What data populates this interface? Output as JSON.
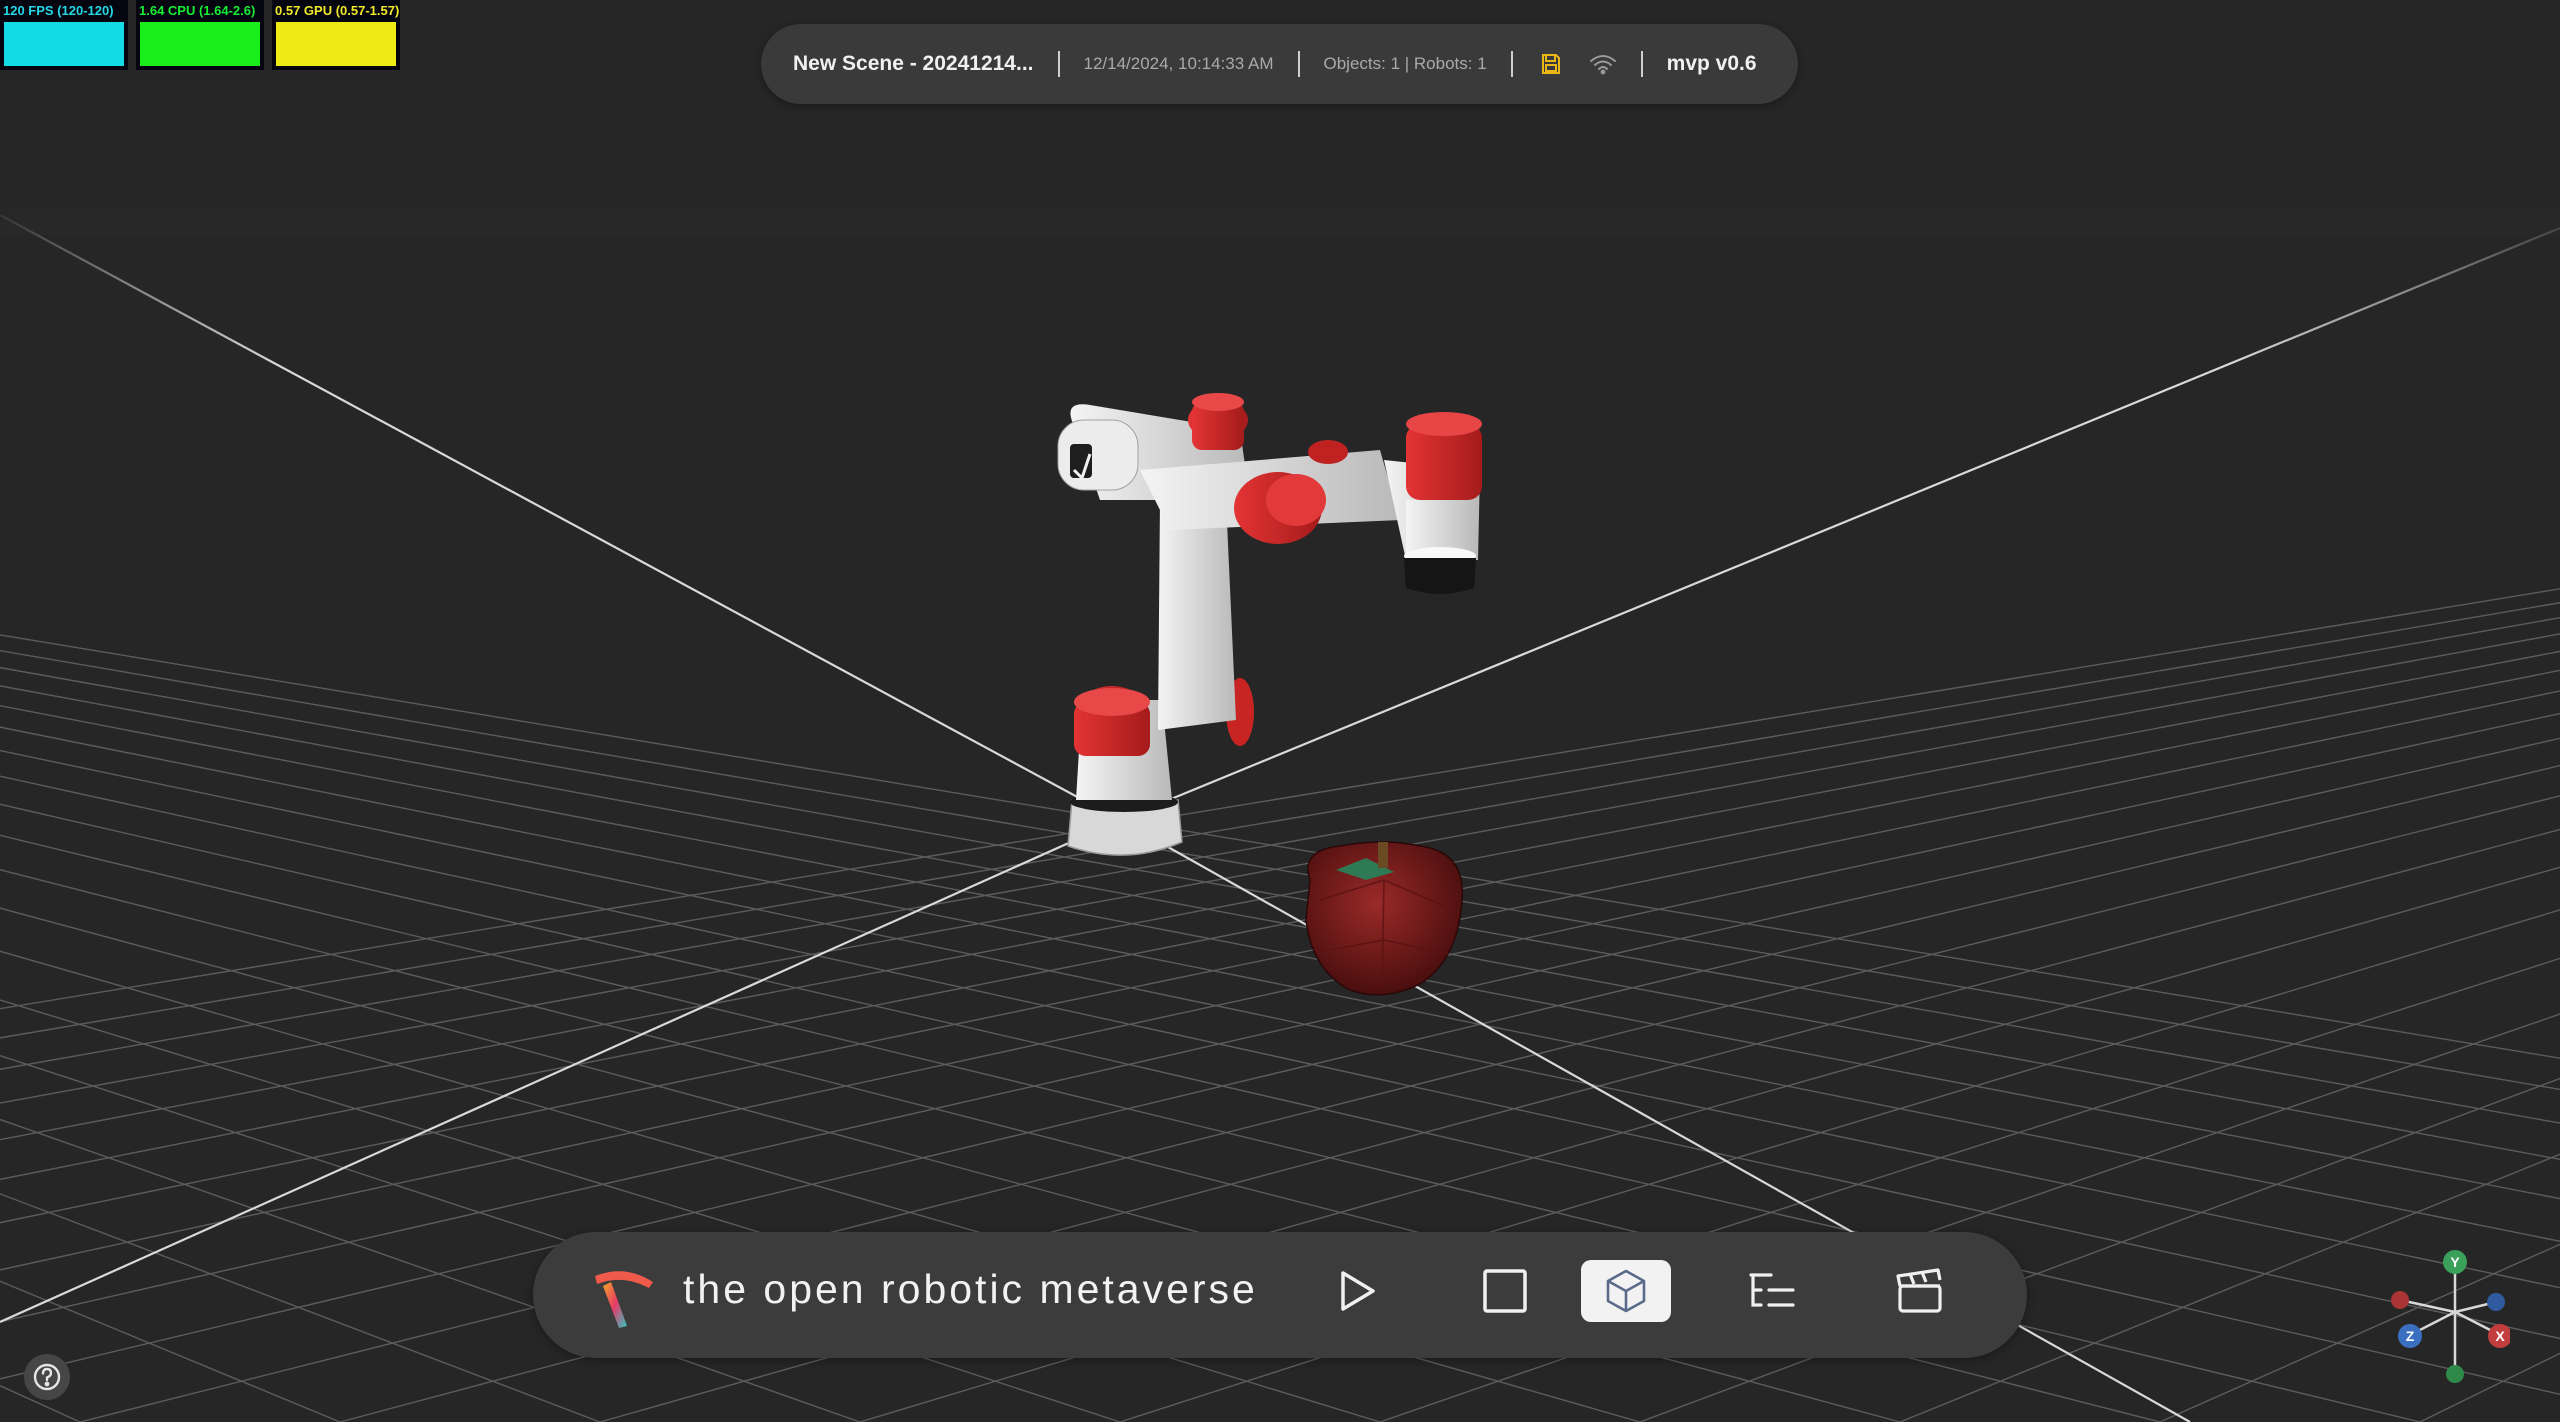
{
  "stats": {
    "fps_label": "120 FPS (120-120)",
    "cpu_label": "1.64 CPU (1.64-2.6)",
    "gpu_label": "0.57 GPU (0.57-1.57)",
    "fps_color": "#13dbe6",
    "cpu_color": "#1aee1a",
    "gpu_color": "#eeea14"
  },
  "topbar": {
    "scene_name": "New Scene - 20241214...",
    "timestamp": "12/14/2024, 10:14:33 AM",
    "counts": "Objects: 1 | Robots: 1",
    "version": "mvp v0.6",
    "save_icon": "save-icon",
    "wifi_icon": "wifi-icon",
    "save_color": "#e8b818"
  },
  "toolbar": {
    "tagline": "the open robotic metaverse",
    "buttons": [
      "play-icon",
      "stop-icon",
      "cube-icon",
      "tree-list-icon",
      "clapperboard-icon"
    ],
    "active_button": "cube-icon"
  },
  "help": {
    "icon": "question-circle-icon"
  },
  "gizmo": {
    "x_label": "X",
    "y_label": "Y",
    "z_label": "Z",
    "x_color": "#c23d3d",
    "y_color": "#3aa05a",
    "z_color": "#3a6fc2"
  },
  "colors": {
    "background": "#262626",
    "panel": "#3a3a3a",
    "robot_accent": "#d32a2a"
  }
}
